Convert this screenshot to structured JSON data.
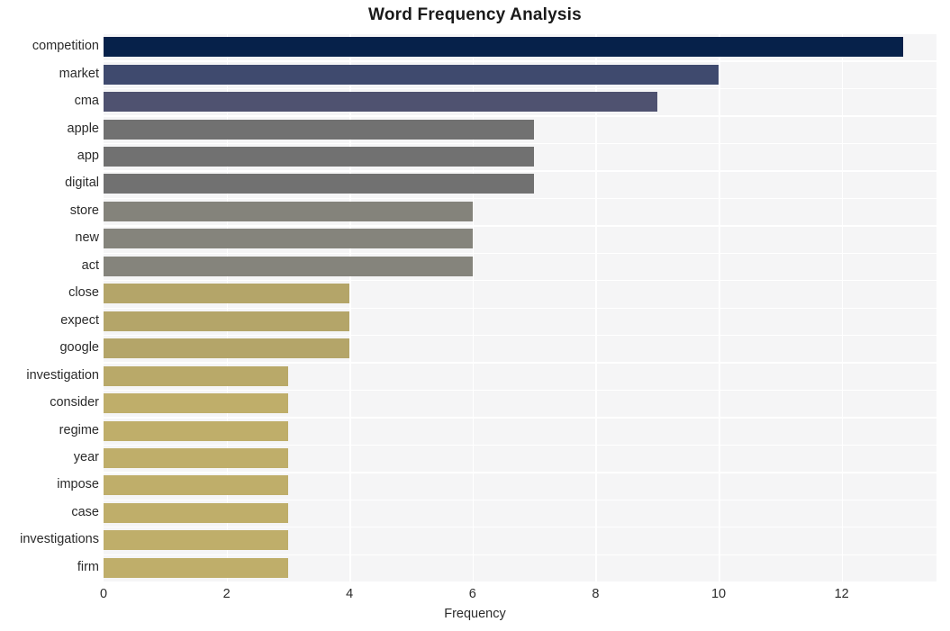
{
  "chart_data": {
    "type": "bar",
    "orientation": "horizontal",
    "title": "Word Frequency Analysis",
    "xlabel": "Frequency",
    "ylabel": "",
    "xlim": [
      0,
      13
    ],
    "xticks": [
      0,
      2,
      4,
      6,
      8,
      10,
      12
    ],
    "xtick_labels": [
      "0",
      "2",
      "4",
      "6",
      "8",
      "10",
      "12"
    ],
    "grid": true,
    "grid_color": "#ffffff",
    "plot_background": "#f5f5f6",
    "figure_background": "#ffffff",
    "legend": null,
    "categories": [
      "competition",
      "market",
      "cma",
      "apple",
      "app",
      "digital",
      "store",
      "new",
      "act",
      "close",
      "expect",
      "google",
      "investigation",
      "consider",
      "regime",
      "year",
      "impose",
      "case",
      "investigations",
      "firm"
    ],
    "values": [
      13,
      10,
      9,
      7,
      7,
      7,
      6,
      6,
      6,
      4,
      4,
      4,
      3,
      3,
      3,
      3,
      3,
      3,
      3,
      3
    ],
    "bar_colors": [
      "#06214a",
      "#3f4a6e",
      "#4f5270",
      "#717171",
      "#717171",
      "#717171",
      "#84837b",
      "#85847c",
      "#85847c",
      "#b4a569",
      "#b4a569",
      "#b4a569",
      "#b9a969",
      "#bfae6a",
      "#bfae6a",
      "#bfae6a",
      "#bfae6a",
      "#bfae6a",
      "#bfae6a",
      "#bfae6a"
    ]
  }
}
